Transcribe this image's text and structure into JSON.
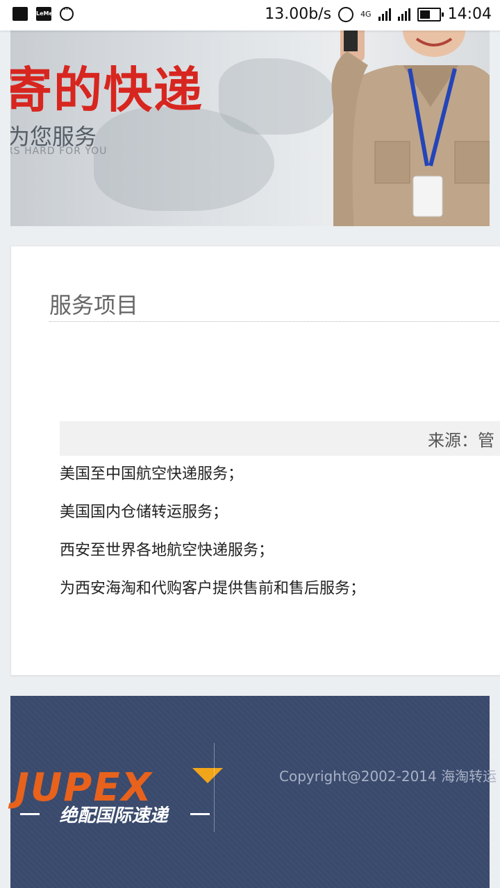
{
  "status_bar": {
    "speed": "13.00b/s",
    "network": "4G",
    "time": "14:04"
  },
  "banner": {
    "headline": "寄的快递",
    "subtitle": "为您服务",
    "english": "RS HARD FOR YOU"
  },
  "section": {
    "title": "服务项目",
    "source": "来源：管",
    "services": [
      "美国至中国航空快递服务；",
      "美国国内仓储转运服务；",
      "西安至世界各地航空快递服务；",
      "为西安海淘和代购客户提供售前和售后服务；"
    ]
  },
  "footer": {
    "logo_text": "JUPEX",
    "logo_sub": "绝配国际速递",
    "copyright": "Copyright@2002-2014 海淘转运"
  },
  "colors": {
    "headline": "#d7261f",
    "footer_bg": "#3a4a6d",
    "logo_orange": "#e8621c"
  }
}
